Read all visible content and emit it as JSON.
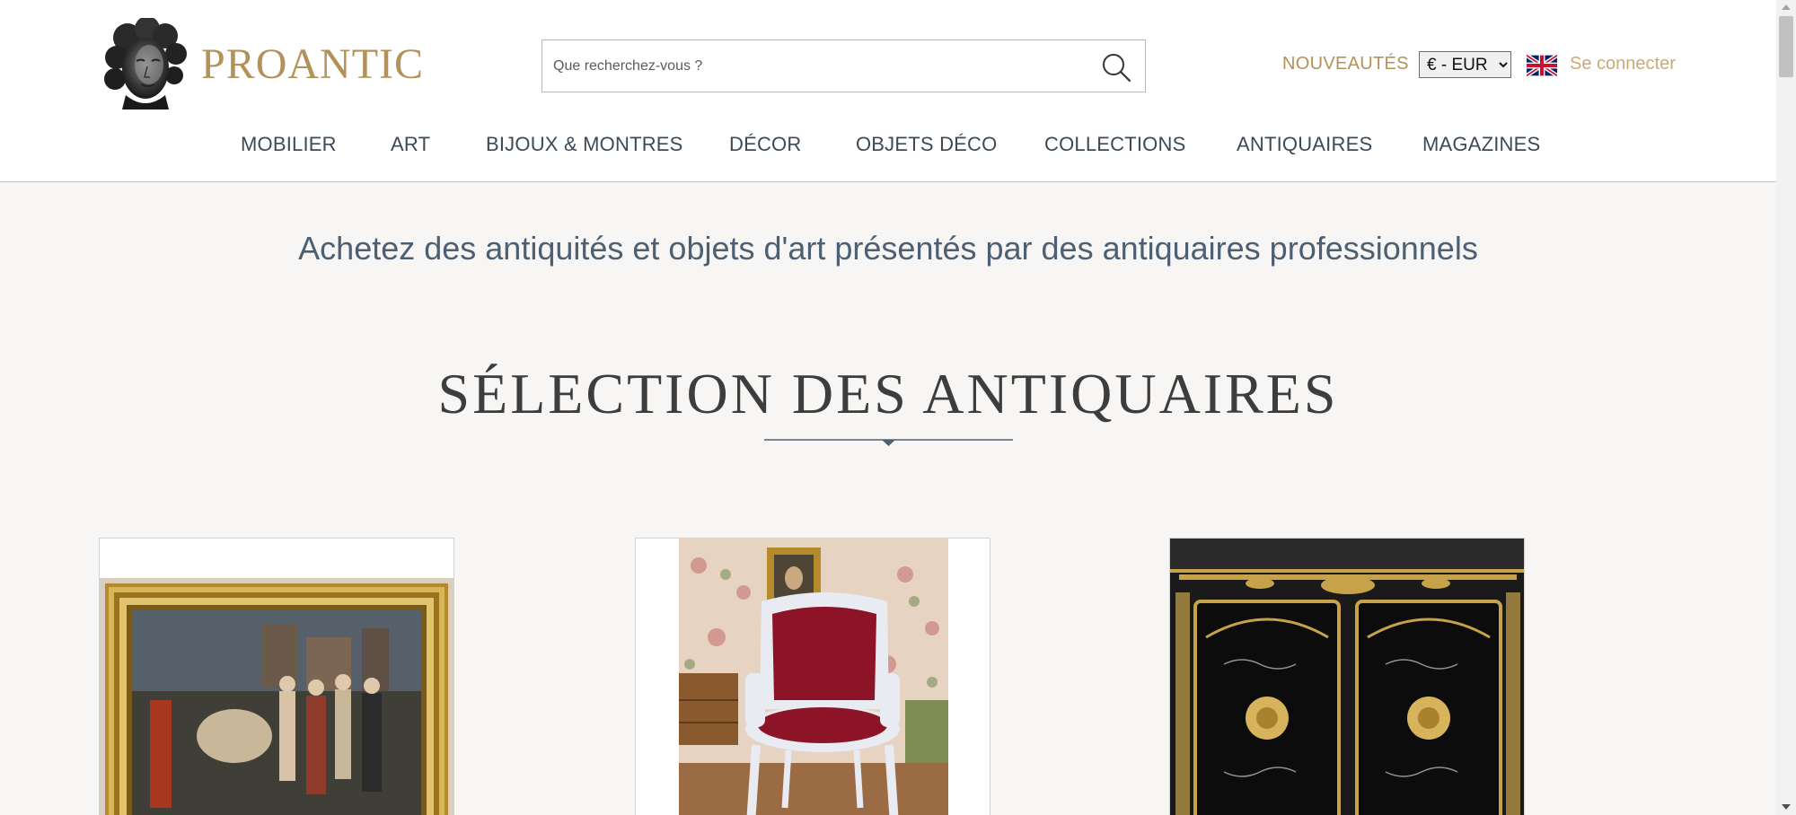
{
  "header": {
    "logo_text": "PROANTIC",
    "search": {
      "placeholder": "Que recherchez-vous ?",
      "value": ""
    },
    "nouveautes_label": "NOUVEAUTÉS",
    "currency": {
      "selected": "€ - EUR",
      "options": [
        "€ - EUR"
      ]
    },
    "language_flag": "uk-flag-icon",
    "login_label": "Se connecter"
  },
  "nav": {
    "items": [
      {
        "label": "MOBILIER"
      },
      {
        "label": "ART"
      },
      {
        "label": "BIJOUX & MONTRES"
      },
      {
        "label": "DÉCOR"
      },
      {
        "label": "OBJETS DÉCO"
      },
      {
        "label": "COLLECTIONS"
      },
      {
        "label": "ANTIQUAIRES"
      },
      {
        "label": "MAGAZINES"
      }
    ]
  },
  "main": {
    "tagline": "Achetez des antiquités et objets d'art présentés par des antiquaires professionnels",
    "section_title": "SÉLECTION DES ANTIQUAIRES",
    "products": [
      {
        "image": "framed-painting-image"
      },
      {
        "image": "louis-xv-armchair-image"
      },
      {
        "image": "boulle-cabinet-image"
      }
    ]
  },
  "colors": {
    "brand_gold": "#b3925a",
    "nav_text": "#3b4a57",
    "tagline_text": "#4d5f72",
    "background": "#f7f6f4"
  }
}
